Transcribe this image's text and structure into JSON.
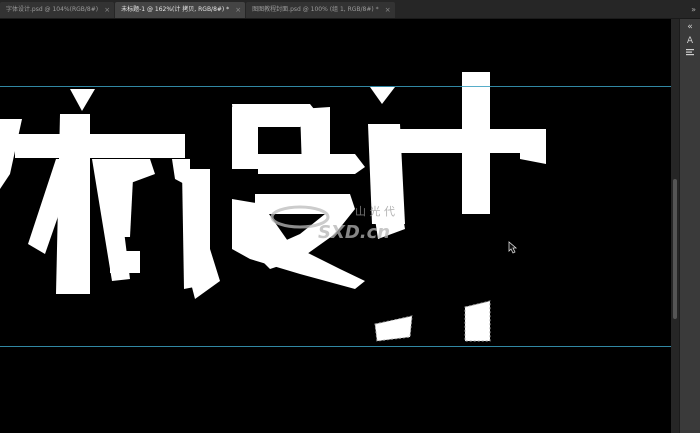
{
  "tabs": [
    {
      "label": "字体设计.psd @ 104%(RGB/8#)",
      "active": false
    },
    {
      "label": "未标题-1 @ 162%(计 拷贝, RGB/8#) *",
      "active": true
    },
    {
      "label": "图图教程封面.psd @ 100% (组 1, RGB/8#) *",
      "active": false
    }
  ],
  "tab_overflow": "»",
  "artwork": {
    "characters": [
      "体",
      "设",
      "计"
    ],
    "watermark_top": "山 光 代",
    "watermark_bottom": "SXD.cn"
  },
  "panel": {
    "expand_icon": "chevron-double-left-icon",
    "character_icon": "character-panel-icon",
    "paragraph_icon": "paragraph-panel-icon",
    "character_glyph": "A"
  },
  "colors": {
    "canvas": "#000000",
    "glyph": "#ffffff",
    "guide": "#3a9fc0",
    "ui_dark": "#262626"
  }
}
